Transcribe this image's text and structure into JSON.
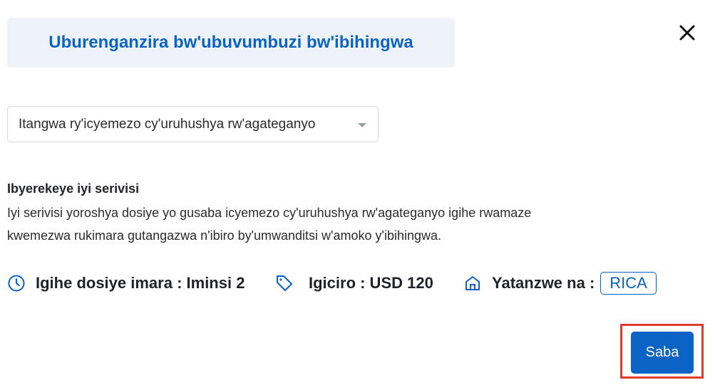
{
  "header": {
    "title": "Uburenganzira bw'ubuvumbuzi bw'ibihingwa",
    "close_icon": "close-icon"
  },
  "service_select": {
    "selected": "Itangwa ry'icyemezo cy'uruhushya rw'agateganyo"
  },
  "description": {
    "heading": "Ibyerekeye iyi serivisi",
    "line1": "Iyi serivisi yoroshya dosiye yo gusaba icyemezo cy'uruhushya rw'agateganyo igihe rwamaze",
    "line2": "kwemezwa rukimara gutangazwa n'ibiro by'umwanditsi w'amoko y'ibihingwa."
  },
  "meta": {
    "duration_label": "Igihe dosiye imara : Iminsi 2",
    "price_label": "Igiciro : USD 120",
    "provider_label": "Yatanzwe na :",
    "provider_badge": "RICA"
  },
  "actions": {
    "submit_label": "Saba"
  },
  "colors": {
    "accent": "#0b63c6",
    "title_bg": "#eef3f9",
    "highlight": "#e23a2c"
  }
}
